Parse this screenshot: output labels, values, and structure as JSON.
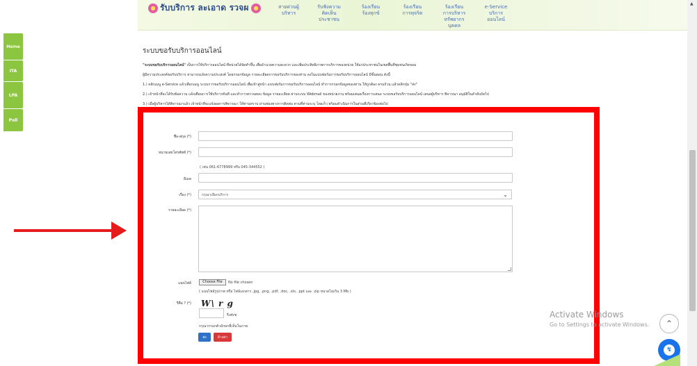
{
  "header": {
    "logo": "รับบริการ ละเอาด รวจผ",
    "nav": [
      "สายด่วนผู้\nบริหาร",
      "รับฟังความ\nคิดเห็น\nประชาชน",
      "ร้องเรียน\nร้องทุกข์",
      "ร้องเรียน\nการทุจริต",
      "ร้องเรียน\nการบริหาร\nทรัพยากร\nบุคคล",
      "e-Service\nบริการ\nออนไลน์"
    ]
  },
  "sidebar": {
    "tabs": [
      "Home",
      "ITA",
      "LPA",
      "Poll"
    ]
  },
  "page": {
    "title": "ระบบขอรับบริการออนไลน์",
    "intro_bold": "\"ระบบขอรับบริการออนไลน์\"",
    "intro_line1": "เป็นการให้บริการออนไลน์ ที่หน่วยได้จัดทำขึ้น เพื่ออำนวยความสะดวก และเพิ่มประสิทธิภาพการบริการของหน่วย ให้แก่ประชาชนในเขตพื้นที่ชุมชนเกิดจอม",
    "intro_line2": "ผู้มีความประสงค์ขอรับบริการ สามารถแจ้งความประสงค์ โดยกรอกข้อมูล รายละเอียดการขอรับบริการของท่าน ลงในแบบฟอร์มการขอรับบริการออนไลน์ มีขั้นตอน ดังนี้",
    "steps": [
      "1.) คลิกเมนู e-Service แล้วเลือกเมนู ระบบการขอรับบริการออนไลน์ เพื่อเข้าสู่หน้า แบบฟอร์มการขอรับบริการออนไลน์ ทำการกรอกข้อมูลของท่าน ให้ถูกต้อง ครบถ้วน แล้วคลิกปุ่ม \"ส่ง\"",
      "2.) เจ้าหน้าที่จะได้รับข้อความ แจ้งเตือนการใช้บริการทันที และทำการตรวจสอบ ข้อมูล รายละเอียด ผ่านระบบ Webmail ของหน่วยงาน พร้อมเสนอเรื่องการเสนอ ระบบขอรับบริการออนไลน์ เสนอผู้บริหาร พิจารณา อนุมัติในลำดับถัดไป",
      "3.) เมื่อผู้บริหารได้พิจารณาแล้ว เจ้าหน้าที่จะแจ้งผลการพิจารณา ให้ท่านทราบ ผ่านช่องทางการติดต่อ ตามที่ท่านระบุ โดยเร็ว พร้อมดำเนินการในส่วนที่เกี่ยวข้องต่อไป"
    ]
  },
  "form": {
    "name_label": "ชื่อ-สกุล (*)",
    "phone_label": "หมายเลขโทรศัพท์ (*)",
    "phone_hint": "( เช่น 061-6778999 หรือ 045-344552 )",
    "email_label": "อีเมล",
    "subject_label": "เรื่อง (*)",
    "subject_selected": "กรุณาเลือกบริการ",
    "detail_label": "รายละเอียด (*)",
    "attach_label": "แนบไฟล์",
    "file_button": "Choose File",
    "file_status": "No file chosen",
    "file_hint": "( แนบไฟล์รูปภาพ หรือ ไฟล์เอกสาร .jpg, .png, .pdf, .doc, .xls, .ppt และ .zip ขนาดไม่เกิน 3 Mb )",
    "captcha_label": "รีคือ ? (*)",
    "captcha_text": "W\\ r g",
    "refresh_label": "รีเฟรช",
    "captcha_hint": "กรุณากรอกตัวอักษรที่เห็นในภาพ",
    "submit_label": "ส่ง",
    "reset_label": "ล้างค่า"
  },
  "watermark": {
    "line1": "Activate Windows",
    "line2": "Go to Settings to activate Windows."
  },
  "colors": {
    "highlight": "#ff0000",
    "sidebar_tab": "#8cc641",
    "submit": "#2f71c6",
    "reset": "#d9383a",
    "messenger": "#1a73e8"
  }
}
